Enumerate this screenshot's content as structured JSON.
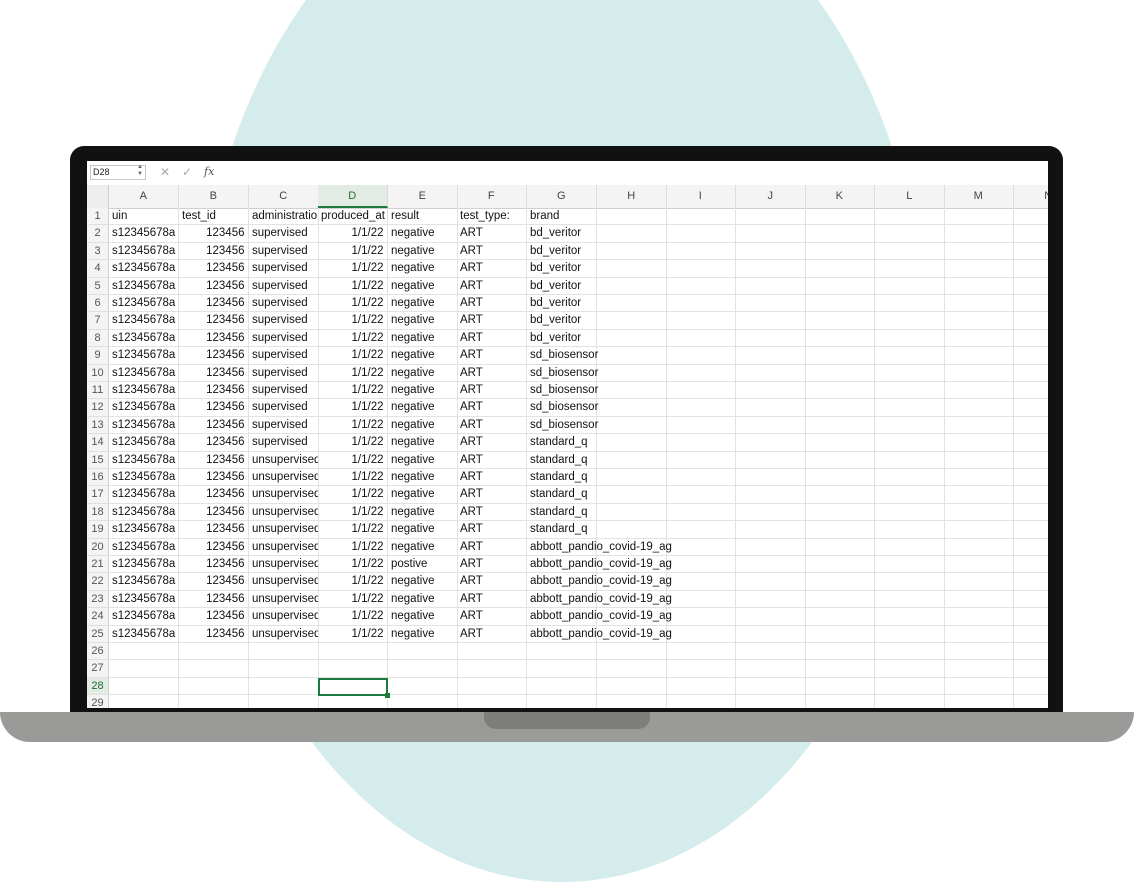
{
  "formula_bar": {
    "cell_ref": "D28",
    "formula": ""
  },
  "column_headers": [
    "A",
    "B",
    "C",
    "D",
    "E",
    "F",
    "G",
    "H",
    "I",
    "J",
    "K",
    "L",
    "M",
    "N"
  ],
  "active_column": "D",
  "active_row": "28",
  "header_row": {
    "row_number": "1",
    "A": "uin",
    "B": "test_id",
    "C": "administration",
    "D": "produced_at",
    "E": "result",
    "F": "test_type:",
    "G": "brand"
  },
  "rows": [
    {
      "n": "2",
      "A": "s12345678a",
      "B": "123456",
      "C": "supervised",
      "D": "1/1/22",
      "E": "negative",
      "F": "ART",
      "G": "bd_veritor"
    },
    {
      "n": "3",
      "A": "s12345678a",
      "B": "123456",
      "C": "supervised",
      "D": "1/1/22",
      "E": "negative",
      "F": "ART",
      "G": "bd_veritor"
    },
    {
      "n": "4",
      "A": "s12345678a",
      "B": "123456",
      "C": "supervised",
      "D": "1/1/22",
      "E": "negative",
      "F": "ART",
      "G": "bd_veritor"
    },
    {
      "n": "5",
      "A": "s12345678a",
      "B": "123456",
      "C": "supervised",
      "D": "1/1/22",
      "E": "negative",
      "F": "ART",
      "G": "bd_veritor"
    },
    {
      "n": "6",
      "A": "s12345678a",
      "B": "123456",
      "C": "supervised",
      "D": "1/1/22",
      "E": "negative",
      "F": "ART",
      "G": "bd_veritor"
    },
    {
      "n": "7",
      "A": "s12345678a",
      "B": "123456",
      "C": "supervised",
      "D": "1/1/22",
      "E": "negative",
      "F": "ART",
      "G": "bd_veritor"
    },
    {
      "n": "8",
      "A": "s12345678a",
      "B": "123456",
      "C": "supervised",
      "D": "1/1/22",
      "E": "negative",
      "F": "ART",
      "G": "bd_veritor"
    },
    {
      "n": "9",
      "A": "s12345678a",
      "B": "123456",
      "C": "supervised",
      "D": "1/1/22",
      "E": "negative",
      "F": "ART",
      "G": "sd_biosensor"
    },
    {
      "n": "10",
      "A": "s12345678a",
      "B": "123456",
      "C": "supervised",
      "D": "1/1/22",
      "E": "negative",
      "F": "ART",
      "G": "sd_biosensor"
    },
    {
      "n": "11",
      "A": "s12345678a",
      "B": "123456",
      "C": "supervised",
      "D": "1/1/22",
      "E": "negative",
      "F": "ART",
      "G": "sd_biosensor"
    },
    {
      "n": "12",
      "A": "s12345678a",
      "B": "123456",
      "C": "supervised",
      "D": "1/1/22",
      "E": "negative",
      "F": "ART",
      "G": "sd_biosensor"
    },
    {
      "n": "13",
      "A": "s12345678a",
      "B": "123456",
      "C": "supervised",
      "D": "1/1/22",
      "E": "negative",
      "F": "ART",
      "G": "sd_biosensor"
    },
    {
      "n": "14",
      "A": "s12345678a",
      "B": "123456",
      "C": "supervised",
      "D": "1/1/22",
      "E": "negative",
      "F": "ART",
      "G": "standard_q"
    },
    {
      "n": "15",
      "A": "s12345678a",
      "B": "123456",
      "C": "unsupervised",
      "D": "1/1/22",
      "E": "negative",
      "F": "ART",
      "G": "standard_q"
    },
    {
      "n": "16",
      "A": "s12345678a",
      "B": "123456",
      "C": "unsupervised",
      "D": "1/1/22",
      "E": "negative",
      "F": "ART",
      "G": "standard_q"
    },
    {
      "n": "17",
      "A": "s12345678a",
      "B": "123456",
      "C": "unsupervised",
      "D": "1/1/22",
      "E": "negative",
      "F": "ART",
      "G": "standard_q"
    },
    {
      "n": "18",
      "A": "s12345678a",
      "B": "123456",
      "C": "unsupervised",
      "D": "1/1/22",
      "E": "negative",
      "F": "ART",
      "G": "standard_q"
    },
    {
      "n": "19",
      "A": "s12345678a",
      "B": "123456",
      "C": "unsupervised",
      "D": "1/1/22",
      "E": "negative",
      "F": "ART",
      "G": "standard_q"
    },
    {
      "n": "20",
      "A": "s12345678a",
      "B": "123456",
      "C": "unsupervised",
      "D": "1/1/22",
      "E": "negative",
      "F": "ART",
      "G": "abbott_pandio_covid-19_ag"
    },
    {
      "n": "21",
      "A": "s12345678a",
      "B": "123456",
      "C": "unsupervised",
      "D": "1/1/22",
      "E": "postive",
      "F": "ART",
      "G": "abbott_pandio_covid-19_ag"
    },
    {
      "n": "22",
      "A": "s12345678a",
      "B": "123456",
      "C": "unsupervised",
      "D": "1/1/22",
      "E": "negative",
      "F": "ART",
      "G": "abbott_pandio_covid-19_ag"
    },
    {
      "n": "23",
      "A": "s12345678a",
      "B": "123456",
      "C": "unsupervised",
      "D": "1/1/22",
      "E": "negative",
      "F": "ART",
      "G": "abbott_pandio_covid-19_ag"
    },
    {
      "n": "24",
      "A": "s12345678a",
      "B": "123456",
      "C": "unsupervised",
      "D": "1/1/22",
      "E": "negative",
      "F": "ART",
      "G": "abbott_pandio_covid-19_ag"
    },
    {
      "n": "25",
      "A": "s12345678a",
      "B": "123456",
      "C": "unsupervised",
      "D": "1/1/22",
      "E": "negative",
      "F": "ART",
      "G": "abbott_pandio_covid-19_ag"
    }
  ],
  "empty_rows": [
    "26",
    "27",
    "28",
    "29"
  ],
  "icons": {
    "cancel": "close-icon",
    "confirm": "check-icon",
    "function": "fx-icon"
  }
}
